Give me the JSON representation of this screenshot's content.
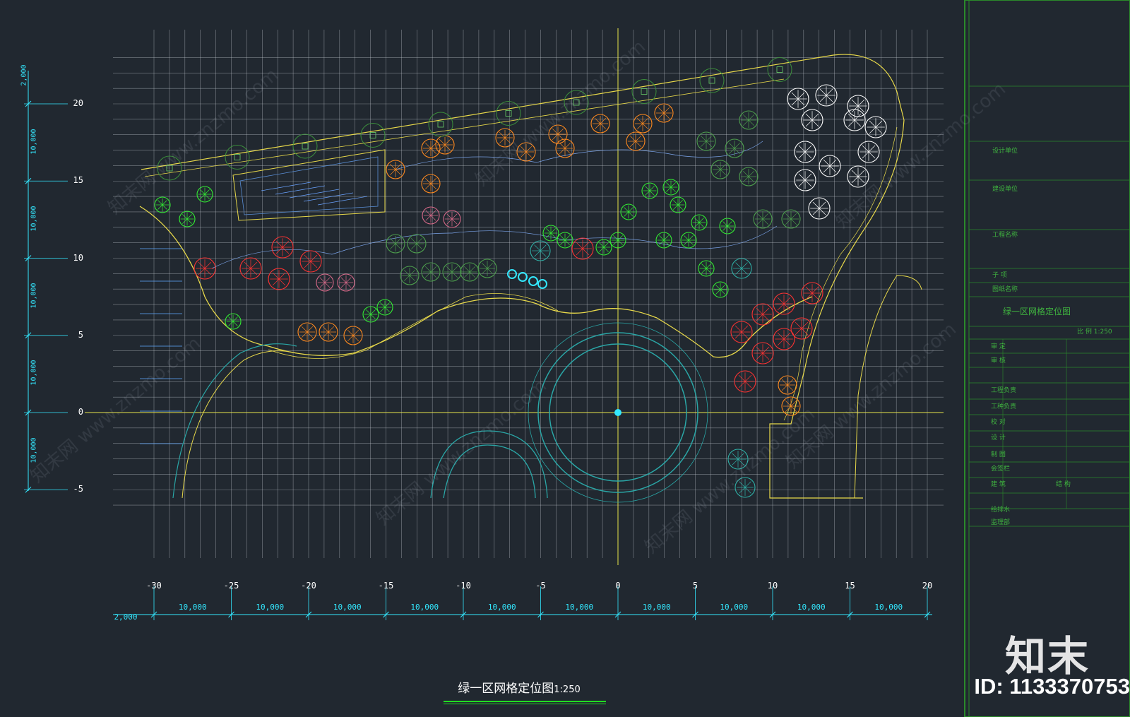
{
  "drawing": {
    "title": "绿一区网格定位图",
    "scale_label": "1:250"
  },
  "grid": {
    "x_ticks": [
      "-30",
      "-25",
      "-20",
      "-15",
      "-10",
      "-5",
      "0",
      "5",
      "10",
      "15",
      "20"
    ],
    "y_ticks": [
      "20",
      "15",
      "10",
      "5",
      "0",
      "-5"
    ],
    "x_dims": [
      "10,000",
      "10,000",
      "10,000",
      "10,000",
      "10,000",
      "10,000",
      "10,000",
      "10,000",
      "10,000",
      "10,000"
    ],
    "x_dim_start": "2,000",
    "y_dims": [
      "10,000",
      "10,000",
      "10,000",
      "10,000",
      "10,000"
    ],
    "y_dim_start": "2,000"
  },
  "title_block": {
    "rows": [
      "设计单位",
      "建设单位",
      "工程名称",
      "子 项",
      "图纸名称",
      "绿一区网格定位图",
      "比 例 1:250",
      "审 定",
      "审 核",
      "工程负责",
      "工种负责",
      "校 对",
      "设 计",
      "制 图",
      "会签栏",
      "建 筑",
      "结 构",
      "给排水",
      "监理部"
    ]
  },
  "brand": {
    "mark": "知末",
    "id_label": "ID: 1133370753"
  },
  "watermark": {
    "text": "知末网 www.znzmo.com"
  },
  "colors": {
    "background": "#212830",
    "grid": "#c9cfd6",
    "axis": "#e8e34a",
    "boundary": "#e8d94a",
    "dimension": "#33e8ff",
    "plaza": "#2aa6a6",
    "tree_red": "#ff3333",
    "tree_orange": "#ff8a1f",
    "tree_green": "#33ee33",
    "tree_white": "#ffffff",
    "title_block": "#2a8a2a"
  }
}
